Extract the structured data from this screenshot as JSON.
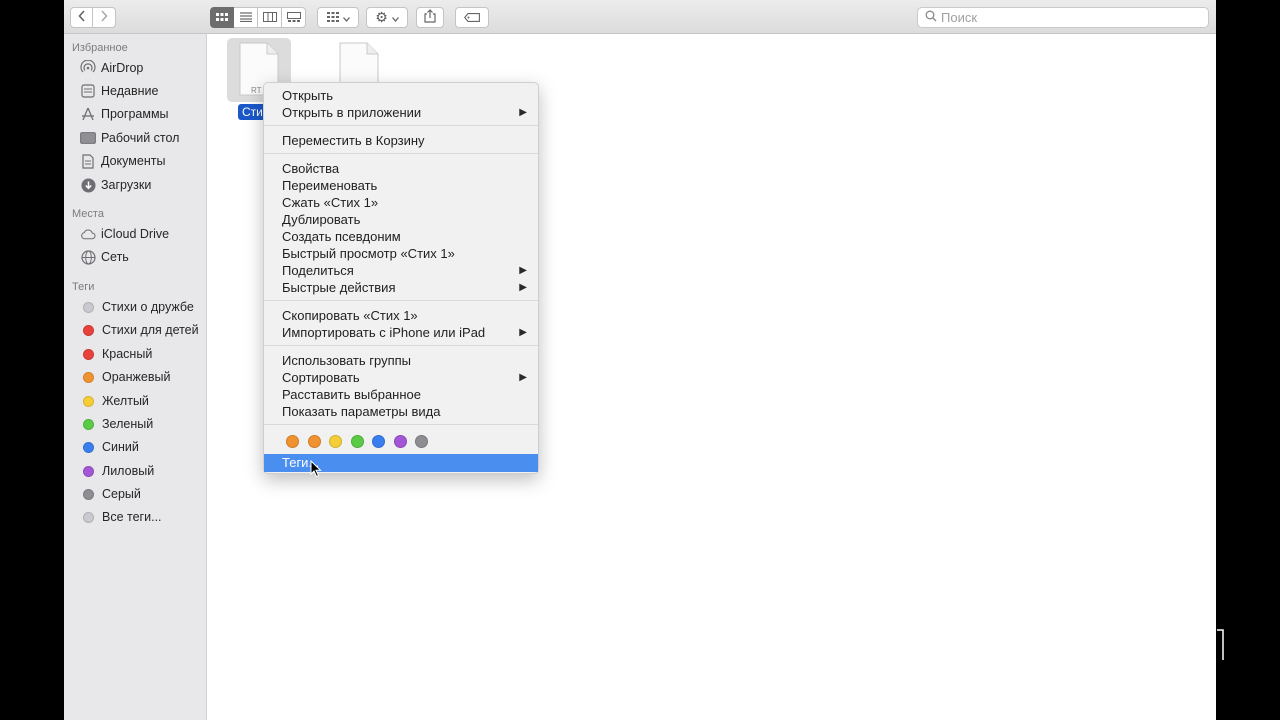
{
  "toolbar": {
    "back_icon": "chevron-left-icon",
    "forward_icon": "chevron-right-icon",
    "view_modes": [
      "icon-view",
      "list-view",
      "column-view",
      "gallery-view"
    ],
    "active_view": "icon-view",
    "search_placeholder": "Поиск"
  },
  "sidebar": {
    "favorites_title": "Избранное",
    "favorites": [
      {
        "label": "AirDrop",
        "icon": "airdrop-icon"
      },
      {
        "label": "Недавние",
        "icon": "recents-icon"
      },
      {
        "label": "Программы",
        "icon": "applications-icon"
      },
      {
        "label": "Рабочий стол",
        "icon": "desktop-icon"
      },
      {
        "label": "Документы",
        "icon": "documents-icon"
      },
      {
        "label": "Загрузки",
        "icon": "downloads-icon"
      }
    ],
    "places_title": "Места",
    "places": [
      {
        "label": "iCloud Drive",
        "icon": "cloud-icon"
      },
      {
        "label": "Сеть",
        "icon": "network-icon"
      }
    ],
    "tags_title": "Теги",
    "tags": [
      {
        "label": "Стихи о дружбе",
        "color": "#c9c9cf"
      },
      {
        "label": "Стихи для детей",
        "color": "#e8413b"
      },
      {
        "label": "Красный",
        "color": "#e8413b"
      },
      {
        "label": "Оранжевый",
        "color": "#f0922f"
      },
      {
        "label": "Желтый",
        "color": "#f5cd37"
      },
      {
        "label": "Зеленый",
        "color": "#5acb45"
      },
      {
        "label": "Синий",
        "color": "#3a7ff0"
      },
      {
        "label": "Лиловый",
        "color": "#a356d6"
      },
      {
        "label": "Серый",
        "color": "#8e8e92"
      },
      {
        "label": "Все теги...",
        "color": "#c9c9cf"
      }
    ]
  },
  "files": [
    {
      "name": "Сти",
      "type_label": "RT",
      "selected": true
    },
    {
      "name": "",
      "type_label": "",
      "selected": false
    }
  ],
  "context_menu": {
    "items": [
      {
        "label": "Открыть",
        "submenu": false
      },
      {
        "label": "Открыть в приложении",
        "submenu": true
      },
      {
        "label": "Переместить в Корзину",
        "submenu": false
      },
      {
        "label": "Свойства",
        "submenu": false
      },
      {
        "label": "Переименовать",
        "submenu": false
      },
      {
        "label": "Сжать «Стих 1»",
        "submenu": false
      },
      {
        "label": "Дублировать",
        "submenu": false
      },
      {
        "label": "Создать псевдоним",
        "submenu": false
      },
      {
        "label": "Быстрый просмотр «Стих 1»",
        "submenu": false
      },
      {
        "label": "Поделиться",
        "submenu": true
      },
      {
        "label": "Быстрые действия",
        "submenu": true
      },
      {
        "label": "Скопировать «Стих 1»",
        "submenu": false
      },
      {
        "label": "Импортировать с iPhone или iPad",
        "submenu": true
      },
      {
        "label": "Использовать группы",
        "submenu": false
      },
      {
        "label": "Сортировать",
        "submenu": true
      },
      {
        "label": "Расставить выбранное",
        "submenu": false
      },
      {
        "label": "Показать параметры вида",
        "submenu": false
      }
    ],
    "tag_colors": [
      "#f0922f",
      "#f0922f",
      "#f5cd37",
      "#5acb45",
      "#3a7ff0",
      "#a356d6",
      "#8e8e92"
    ],
    "tags_item": "Теги...",
    "highlighted": "Теги..."
  }
}
